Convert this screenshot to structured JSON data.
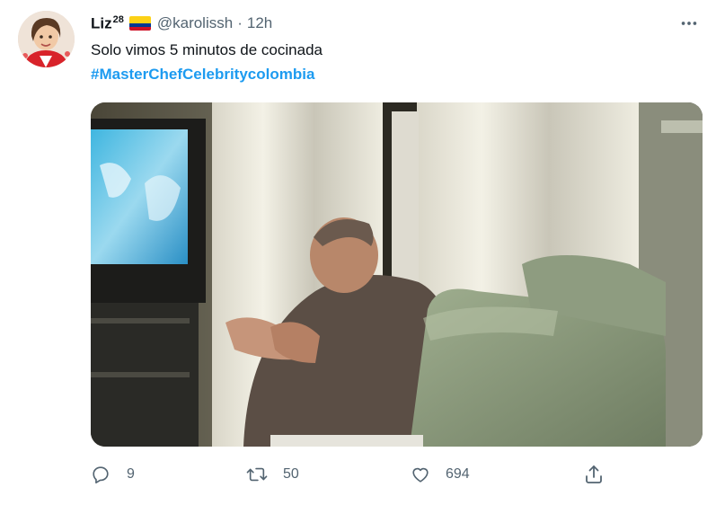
{
  "tweet": {
    "display_name": "Liz",
    "name_superscript": "28",
    "flag": "colombia-flag",
    "handle": "@karolissh",
    "separator": "·",
    "time": "12h",
    "text": "Solo vimos 5 minutos de cocinada",
    "hashtag": "#MasterChefCelebritycolombia",
    "media_alt": "man clapping in front of a TV in a living room"
  },
  "actions": {
    "reply_count": "9",
    "retweet_count": "50",
    "like_count": "694",
    "share_icon": "share-icon"
  },
  "colors": {
    "accent": "#1d9bf0",
    "secondary_text": "#536471",
    "primary_text": "#0f1419"
  }
}
